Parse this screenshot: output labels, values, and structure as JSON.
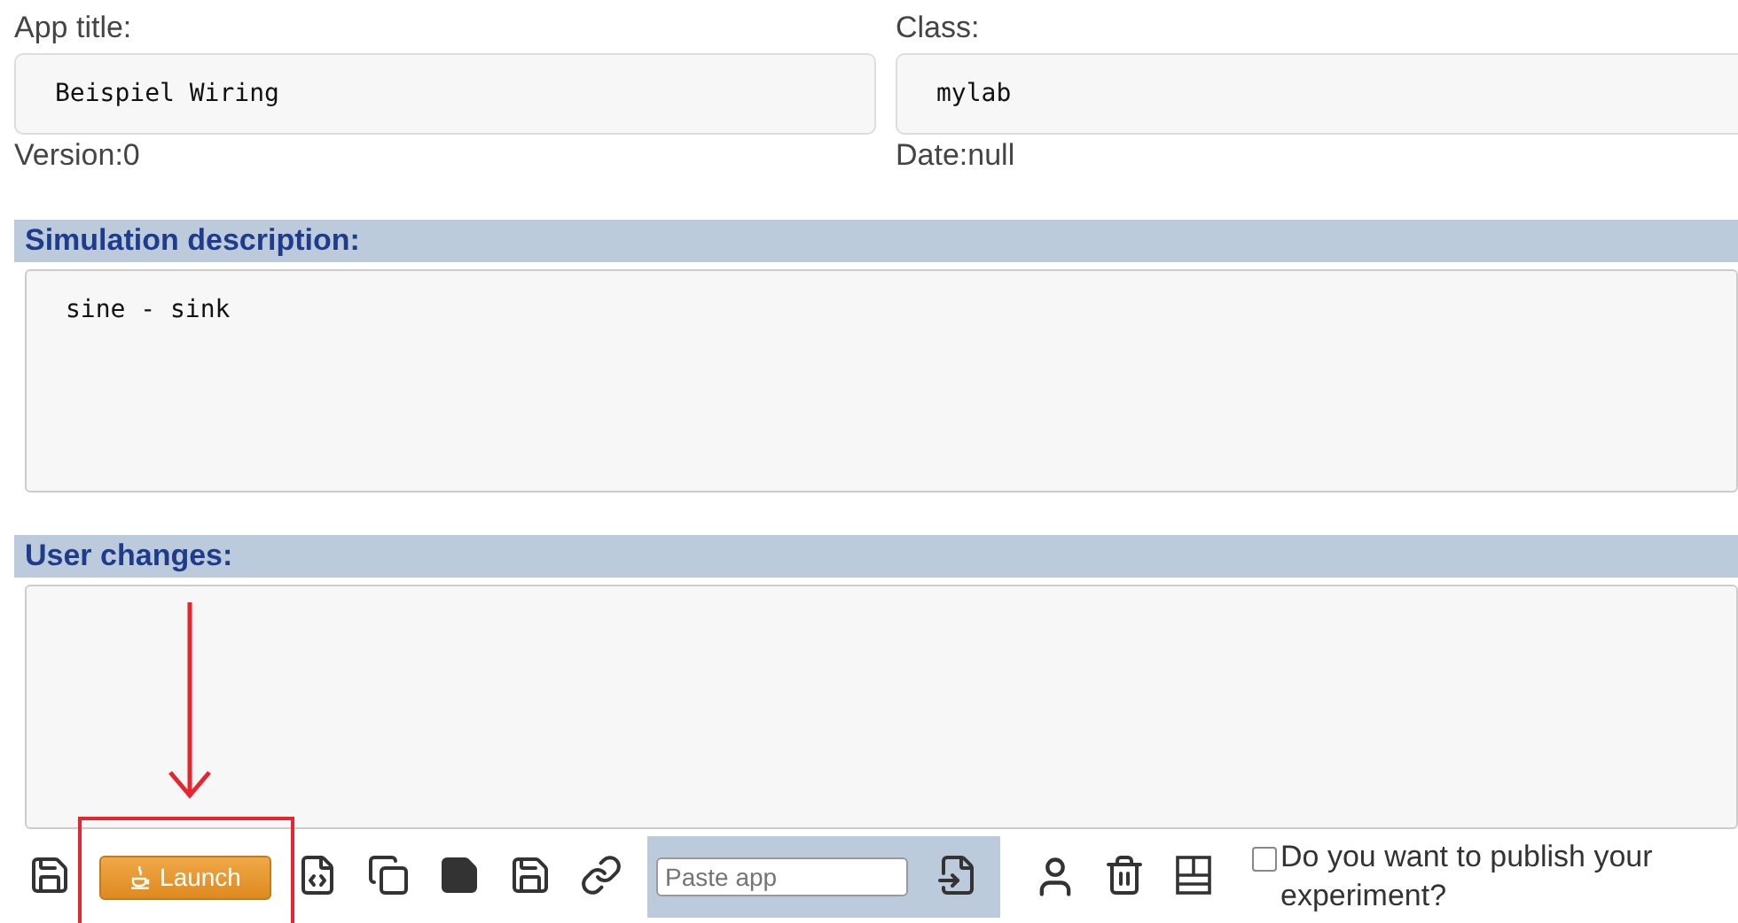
{
  "fields": [
    {
      "label": "App title:",
      "value": "Beispiel Wiring",
      "meta": "Version:0"
    },
    {
      "label": "Class:",
      "value": "mylab",
      "meta": "Date:null"
    }
  ],
  "sections": [
    {
      "heading": "Simulation description:",
      "value": "sine - sink"
    },
    {
      "heading": "User changes:"
    }
  ],
  "toolbar": {
    "launch": "Launch",
    "paste": {
      "placeholder": "Paste app"
    },
    "publish": {
      "label": "Do you want to publish your experiment?",
      "checked": false
    }
  },
  "callout": {
    "kind": "arrow-box"
  }
}
